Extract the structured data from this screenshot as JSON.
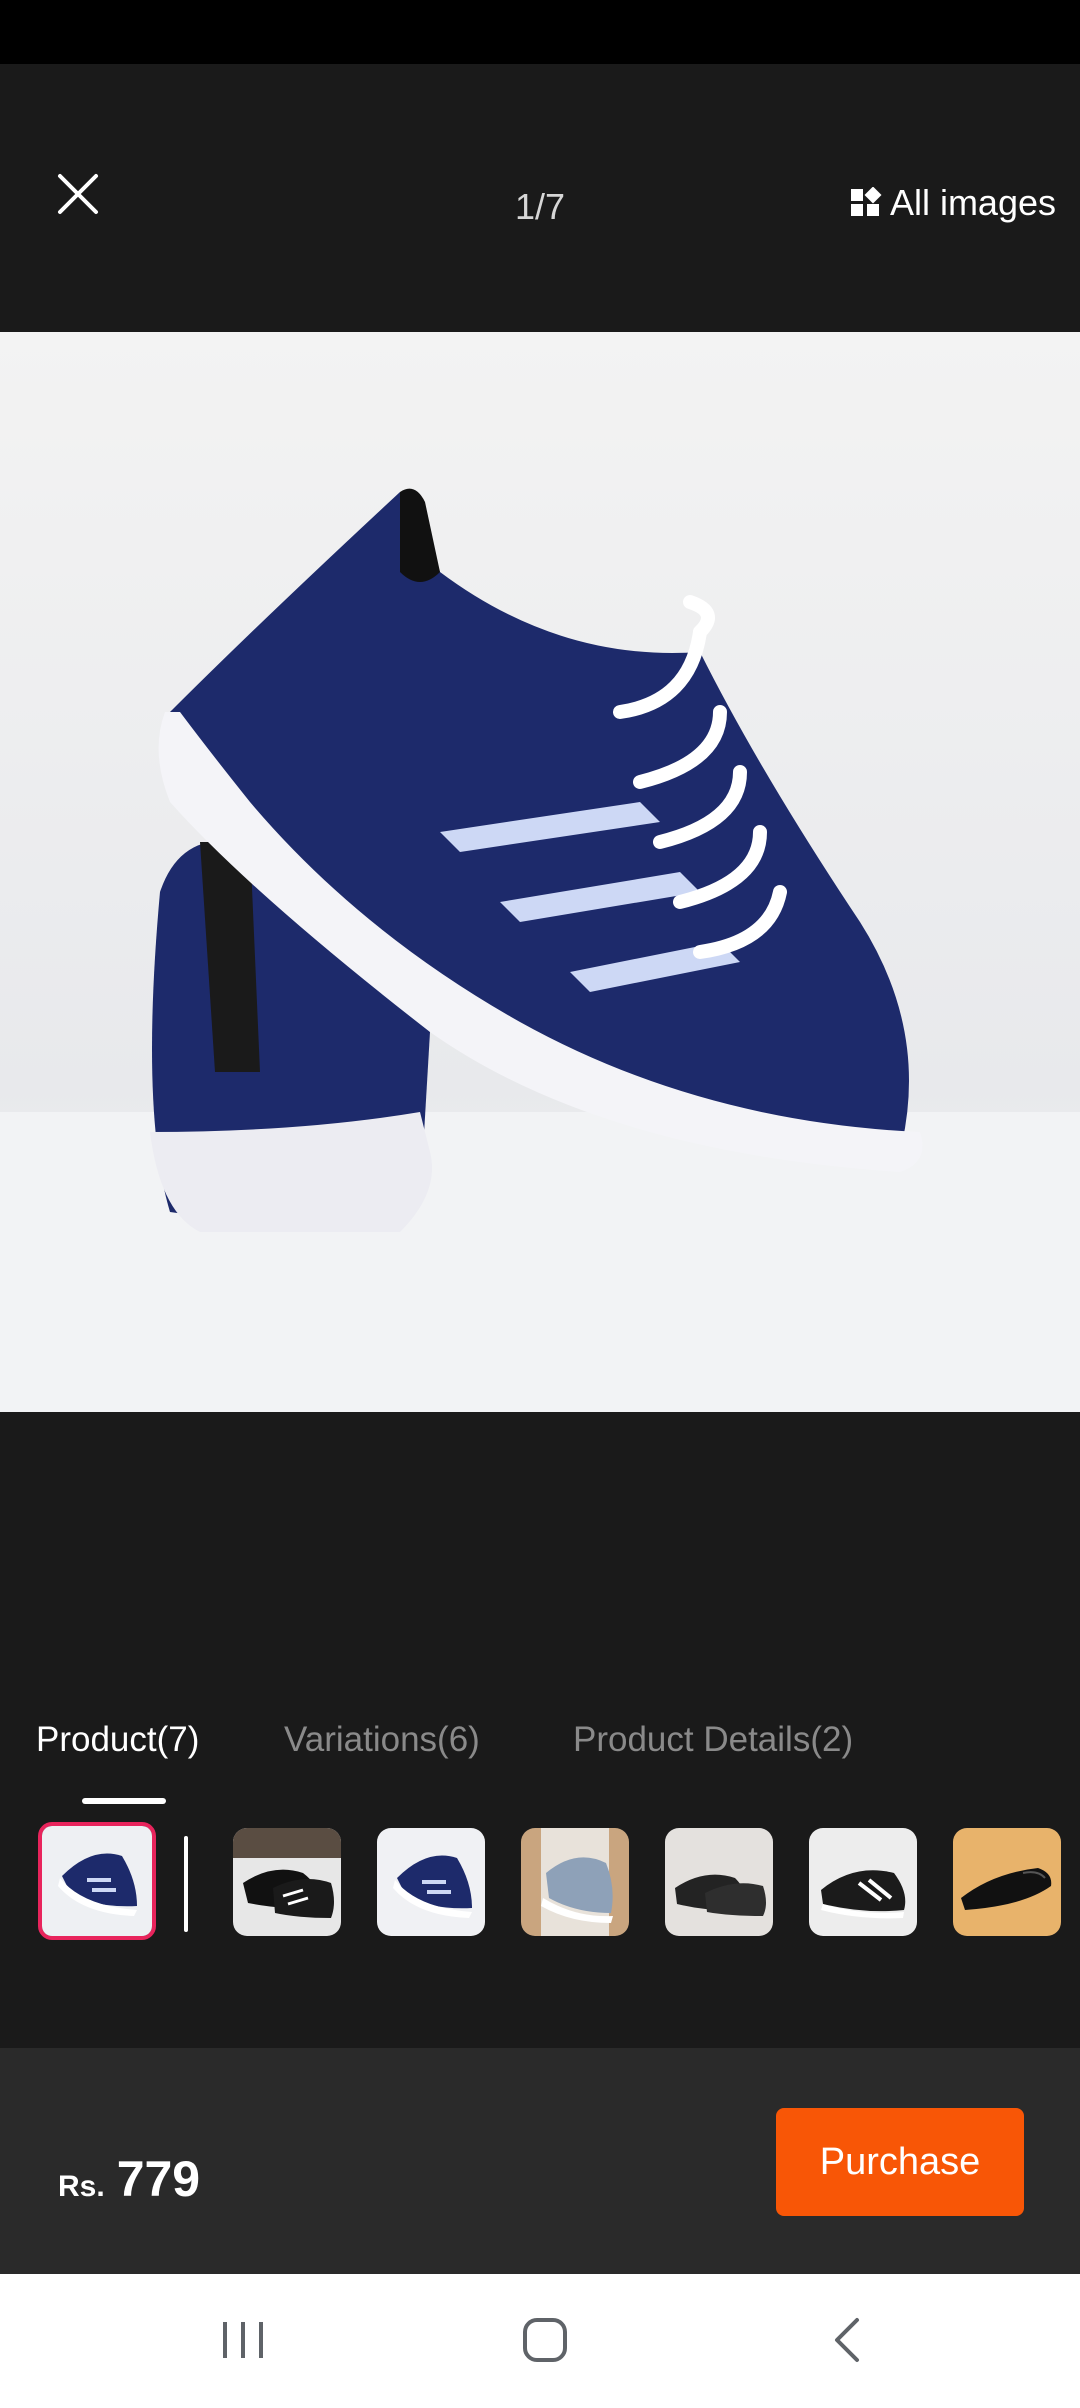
{
  "viewer": {
    "counter": "1/7",
    "all_images_label": "All images"
  },
  "tabs": [
    {
      "label": "Product(7)",
      "active": true
    },
    {
      "label": "Variations(6)",
      "active": false
    },
    {
      "label": "Product Details(2)",
      "active": false
    }
  ],
  "footer": {
    "currency": "Rs.",
    "price": "779",
    "purchase_label": "Purchase"
  },
  "colors": {
    "accent": "#f85606",
    "selected_border": "#e8245c",
    "background": "#1a1a1a"
  },
  "icons": {
    "close": "close-icon",
    "all_images": "grid-icon",
    "nav_recents": "recents-icon",
    "nav_home": "home-icon",
    "nav_back": "back-icon"
  }
}
